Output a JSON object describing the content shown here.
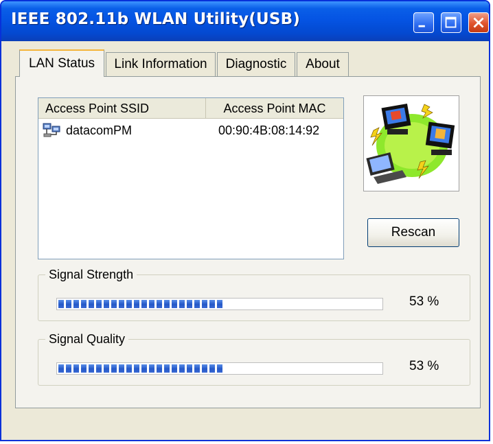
{
  "window": {
    "title": "IEEE 802.11b WLAN Utility(USB)"
  },
  "tabs": [
    {
      "label": "LAN Status",
      "active": true
    },
    {
      "label": "Link Information",
      "active": false
    },
    {
      "label": "Diagnostic",
      "active": false
    },
    {
      "label": "About",
      "active": false
    }
  ],
  "list": {
    "columns": [
      "Access Point SSID",
      "Access Point MAC"
    ],
    "rows": [
      {
        "ssid": "datacomPM",
        "mac": "00:90:4B:08:14:92",
        "icon": "network-computer-icon"
      }
    ]
  },
  "buttons": {
    "rescan": "Rescan"
  },
  "signal_strength": {
    "label": "Signal Strength",
    "value_text": "53 %",
    "value": 53
  },
  "signal_quality": {
    "label": "Signal Quality",
    "value_text": "53 %",
    "value": 53
  },
  "colors": {
    "title_bar": "#0554e3",
    "progress_fill": "#2458c8",
    "close_button": "#e0532c",
    "active_tab_highlight": "#f4b43a"
  }
}
